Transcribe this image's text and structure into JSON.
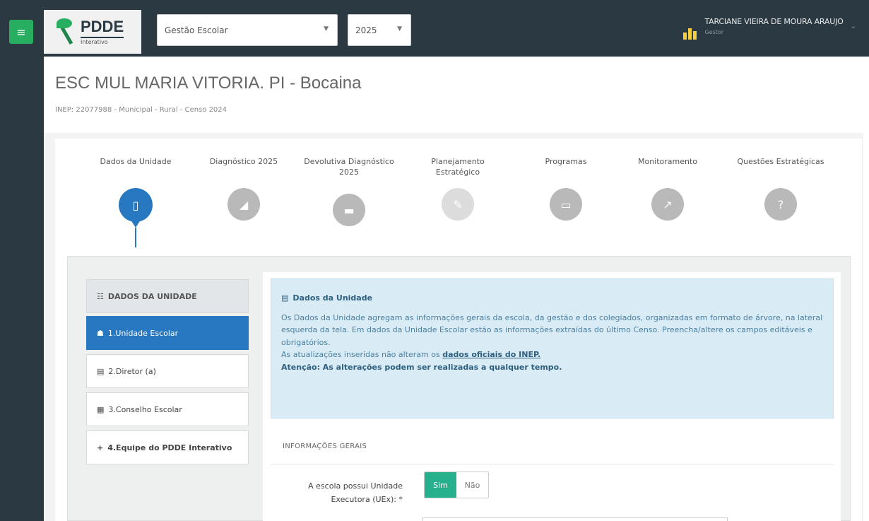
{
  "topbar": {
    "menu_icon": "hamburger-icon",
    "logo": {
      "title": "PDDE",
      "subtitle": "Interativo"
    },
    "profile_select": {
      "value": "Gestão Escolar"
    },
    "year_select": {
      "value": "2025"
    },
    "user": {
      "name": "TARCIANE VIEIRA DE MOURA ARAUJO",
      "role": "Gestor"
    }
  },
  "header": {
    "school_title": "ESC MUL MARIA VITORIA. PI - Bocaina",
    "school_meta": "INEP: 22077988 - Municipal - Rural - Censo 2024"
  },
  "steps": [
    {
      "label": "Dados da Unidade",
      "icon": "document-icon",
      "active": true
    },
    {
      "label": "Diagnóstico 2025",
      "icon": "chart-icon",
      "active": false
    },
    {
      "label": "Devolutiva Diagnóstico 2025",
      "icon": "folder-icon",
      "active": false
    },
    {
      "label": "Planejamento Estratégico",
      "icon": "planning-icon",
      "active": false
    },
    {
      "label": "Programas",
      "icon": "monitor-icon",
      "active": false
    },
    {
      "label": "Monitoramento",
      "icon": "trend-icon",
      "active": false
    },
    {
      "label": "Questões Estratégicas",
      "icon": "question-icon",
      "active": false
    }
  ],
  "sidebar": {
    "header": "DADOS DA UNIDADE",
    "items": [
      {
        "label": "1.Unidade Escolar",
        "icon": "school-icon"
      },
      {
        "label": "2.Diretor (a)",
        "icon": "id-card-icon"
      },
      {
        "label": "3.Conselho Escolar",
        "icon": "group-icon"
      },
      {
        "label": "4.Equipe do PDDE Interativo",
        "icon": "plus-icon"
      }
    ]
  },
  "info": {
    "title": "Dados da Unidade",
    "body": "Os Dados da Unidade agregam as informações gerais da escola, da gestão e dos colegiados, organizadas em formato de árvore, na lateral esquerda da tela. Em dados da Unidade Escolar estão as informações extraídas do último Censo. Preencha/altere os campos editáveis e obrigatórios.",
    "updates_prefix": "As atualizações inseridas não alteram os ",
    "updates_link": "dados oficiais do INEP.",
    "attention": "Atenção: As alterações podem ser realizadas a qualquer tempo."
  },
  "form": {
    "section": "INFORMAÇÕES GERAIS",
    "question_line1": "A escola possui Unidade",
    "question_line2": "Executora (UEx): *",
    "yes": "Sim",
    "no": "Não",
    "selected": "Sim"
  }
}
